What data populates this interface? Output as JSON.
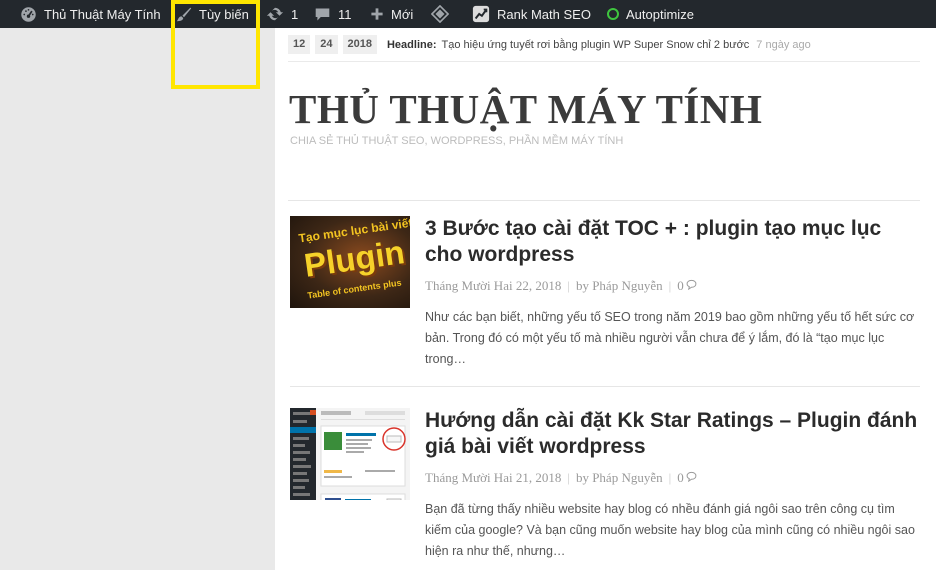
{
  "admin_bar": {
    "site_name": "Thủ Thuật Máy Tính",
    "customize_label": "Tùy biến",
    "updates_count": "1",
    "comments_count": "11",
    "new_label": "Mới",
    "rankmath_label": "Rank Math SEO",
    "autoptimize_label": "Autoptimize"
  },
  "ticker": {
    "date_day": "12",
    "date_month": "24",
    "date_year": "2018",
    "label": "Headline:",
    "text": "Tạo hiệu ứng tuyết rơi bằng plugin WP Super Snow chỉ 2 bước",
    "ago": "7 ngày ago"
  },
  "site": {
    "title": "THỦ THUẬT MÁY TÍNH",
    "description": "CHIA SẺ THỦ THUẬT SEO, WORDPRESS, PHẦN MỀM MÁY TÍNH"
  },
  "posts": [
    {
      "title": "3 Bước tạo cài đặt TOC + : plugin tạo mục lục cho wordpress",
      "date": "Tháng Mười Hai 22, 2018",
      "author": "by Pháp Nguyễn",
      "comments": "0",
      "excerpt": "Như các bạn biết, những yếu tố SEO trong năm 2019 bao gồm những yếu tố hết sức cơ bản. Trong đó có một yếu tố mà nhiều người vẫn chưa để ý lắm, đó là “tạo mục lục trong…",
      "thumb_text_top": "Tạo mục lục bài viết với",
      "thumb_text_main": "Plugin",
      "thumb_text_bottom": "Table of contents plus"
    },
    {
      "title": "Hướng dẫn cài đặt Kk Star Ratings – Plugin đánh giá bài viết wordpress",
      "date": "Tháng Mười Hai 21, 2018",
      "author": "by Pháp Nguyễn",
      "comments": "0",
      "excerpt": "Bạn đã từng thấy nhiều website hay blog có nhều đánh giá ngôi sao trên công cụ tìm kiếm của google? Và bạn cũng muốn website hay blog của mình cũng có nhiều ngôi sao hiện ra như thế, nhưng…"
    }
  ],
  "colors": {
    "admin_bar": "#23282d",
    "highlight": "#ffe600",
    "autoptimize_status": "#3fc53f"
  },
  "icons": [
    "dashboard-icon",
    "brush-icon",
    "update-icon",
    "comment-icon",
    "plus-icon",
    "diamond-icon",
    "rankmath-icon",
    "status-dot-icon",
    "comment-bubble-icon"
  ]
}
